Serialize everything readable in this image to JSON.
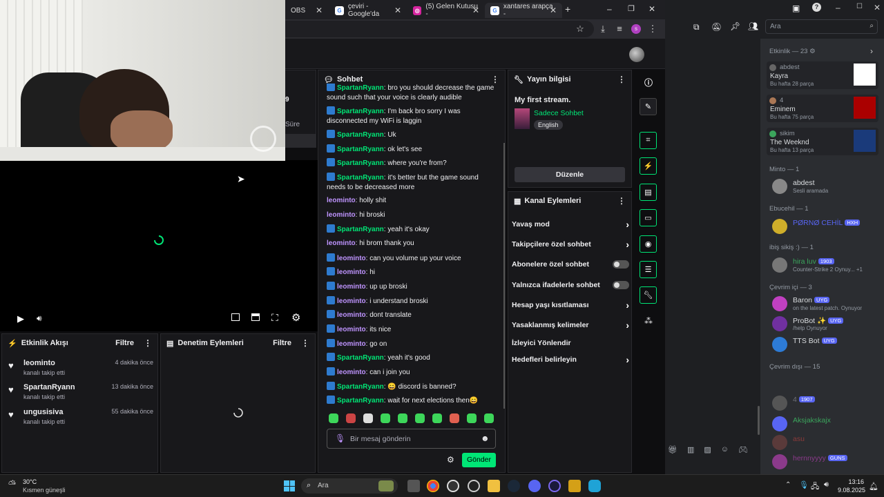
{
  "browser": {
    "tabs": [
      {
        "label": "OBS"
      },
      {
        "label": "çeviri - Google'da"
      },
      {
        "label": "(5) Gelen Kutusu -"
      },
      {
        "label": "xantares arapça -"
      }
    ],
    "new_tab": "+",
    "window_controls": {
      "minimize": "–",
      "maximize": "❐",
      "close": "✕"
    }
  },
  "webcam": {
    "partial_line1": "9",
    "partial_line2": "Süre"
  },
  "activity_feed": {
    "title": "Etkinlik Akışı",
    "filter": "Filtre",
    "items": [
      {
        "name": "leominto",
        "sub": "kanalı takip etti",
        "time": "4 dakika önce"
      },
      {
        "name": "SpartanRyann",
        "sub": "kanalı takip etti",
        "time": "13 dakika önce"
      },
      {
        "name": "ungusisiva",
        "sub": "kanalı takip etti",
        "time": "55 dakika önce"
      }
    ]
  },
  "mod_actions": {
    "title": "Denetim Eylemleri",
    "filter": "Filtre"
  },
  "chat": {
    "title": "Sohbet",
    "messages": [
      {
        "user": "SpartanRyann",
        "text": "bro you should decrease the game sound such that your voice is clearly audible",
        "badge": true
      },
      {
        "user": "SpartanRyann",
        "text": "I'm back bro sorry I was disconnected my WiFi is laggin",
        "badge": true
      },
      {
        "user": "SpartanRyann",
        "text": "Uk",
        "badge": true
      },
      {
        "user": "SpartanRyann",
        "text": "ok let's see",
        "badge": true
      },
      {
        "user": "SpartanRyann",
        "text": "where you're from?",
        "badge": true
      },
      {
        "user": "SpartanRyann",
        "text": "it's better but the game sound needs to be decreased more",
        "badge": true
      },
      {
        "user": "leominto",
        "text": "holly shit",
        "badge": false
      },
      {
        "user": "leominto",
        "text": "hi broski",
        "badge": false
      },
      {
        "user": "SpartanRyann",
        "text": "yeah it's okay",
        "badge": true
      },
      {
        "user": "leominto",
        "text": "hi brom thank you",
        "badge": false
      },
      {
        "user": "leominto",
        "text": "can you volume up your voice",
        "badge": true
      },
      {
        "user": "leominto",
        "text": "hi",
        "badge": true
      },
      {
        "user": "leominto",
        "text": "up up broski",
        "badge": true
      },
      {
        "user": "leominto",
        "text": "i understand broski",
        "badge": true
      },
      {
        "user": "leominto",
        "text": "dont translate",
        "badge": true
      },
      {
        "user": "leominto",
        "text": "its nice",
        "badge": true
      },
      {
        "user": "leominto",
        "text": "go on",
        "badge": true
      },
      {
        "user": "SpartanRyann",
        "text": "yeah it's good",
        "badge": true
      },
      {
        "user": "leominto",
        "text": "can i join you",
        "badge": true
      },
      {
        "user": "SpartanRyann",
        "text": "😄 discord is banned?",
        "badge": true
      },
      {
        "user": "SpartanRyann",
        "text": "wait for next elections then😄",
        "badge": true
      }
    ],
    "input_placeholder": "Bir mesaj gönderin",
    "send": "Gönder"
  },
  "stream_info": {
    "title": "Yayın bilgisi",
    "stream_title": "My first stream.",
    "category": "Sadece Sohbet",
    "language": "English",
    "edit": "Düzenle"
  },
  "channel_actions": {
    "title": "Kanal Eylemleri",
    "items": [
      {
        "label": "Yavaş mod",
        "control": "chevron"
      },
      {
        "label": "Takipçilere özel sohbet",
        "control": "chevron"
      },
      {
        "label": "Abonelere özel sohbet",
        "control": "toggle"
      },
      {
        "label": "Yalnızca ifadelerle sohbet",
        "control": "toggle"
      },
      {
        "label": "Hesap yaşı kısıtlaması",
        "control": "chevron"
      },
      {
        "label": "Yasaklanmış kelimeler",
        "control": "chevron"
      },
      {
        "label": "İzleyici Yönlendir",
        "control": "none"
      },
      {
        "label": "Hedefleri belirleyin",
        "control": "chevron"
      }
    ]
  },
  "discord": {
    "search_placeholder": "Ara",
    "activity_header": "Etkinlik — 23 ⚙",
    "activity_cards": [
      {
        "user": "abdest",
        "title": "Kayra",
        "sub": "Bu hafta 28 parça"
      },
      {
        "user": "4",
        "title": "Eminem",
        "sub": "Bu hafta 75 parça"
      },
      {
        "user": "sikim",
        "title": "The Weeknd",
        "sub": "Bu hafta 13 parça"
      }
    ],
    "groups": [
      {
        "header": "Minto — 1",
        "members": [
          {
            "name": "abdest",
            "sub": "Sesli aramada",
            "tag": "",
            "color": "#dbdee1"
          }
        ]
      },
      {
        "header": "Ebucehil — 1",
        "members": [
          {
            "name": "PØRNØ CEHİL",
            "sub": "",
            "tag": "HXH",
            "color": "#5865f2"
          }
        ]
      },
      {
        "header": "ibiş sikiş :) — 1",
        "members": [
          {
            "name": "hira luv",
            "sub": "Counter-Strike 2 Oynuy... +1",
            "tag": "1903",
            "color": "#3ba55c"
          }
        ]
      },
      {
        "header": "Çevrim içi — 3",
        "members": [
          {
            "name": "Baron",
            "sub": "on the latest patch. Oynuyor",
            "tag": "UYG",
            "color": "#dbdee1"
          },
          {
            "name": "ProBot ✨",
            "sub": "/help Oynuyor",
            "tag": "UYG",
            "color": "#dbdee1"
          },
          {
            "name": "TTS Bot",
            "sub": "",
            "tag": "UYG",
            "color": "#dbdee1"
          }
        ]
      },
      {
        "header": "Çevrim dışı — 15",
        "members": [
          {
            "name": "4",
            "sub": "",
            "tag": "1907",
            "color": "#6d6f78"
          },
          {
            "name": "Aksjakskajx",
            "sub": "",
            "tag": "",
            "color": "#3ba55c"
          },
          {
            "name": "asu",
            "sub": "",
            "tag": "",
            "color": "#8b3a3a"
          },
          {
            "name": "hernnyyyy",
            "sub": "",
            "tag": "GUNS",
            "color": "#8b3a8b"
          }
        ]
      }
    ]
  },
  "taskbar": {
    "weather_temp": "30°C",
    "weather_desc": "Kısmen güneşli",
    "search": "Ara",
    "time": "13:16",
    "date": "9.08.2025"
  }
}
